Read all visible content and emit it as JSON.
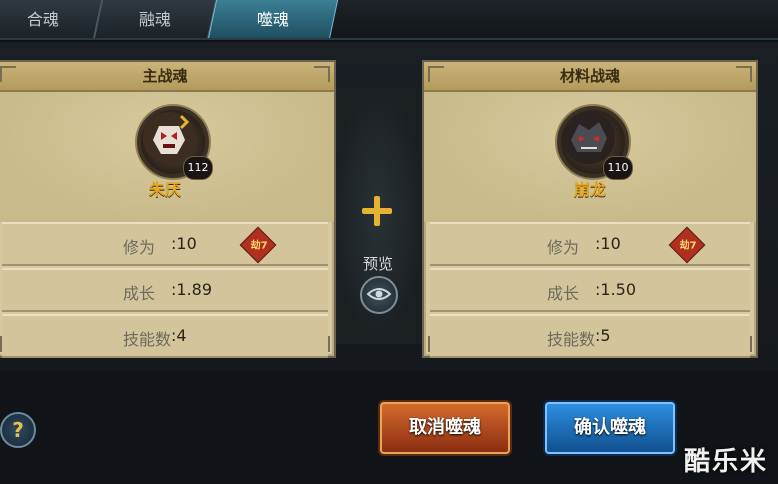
{
  "tabs": [
    {
      "label": "合魂",
      "active": false
    },
    {
      "label": "融魂",
      "active": false
    },
    {
      "label": "噬魂",
      "active": true
    }
  ],
  "main_soul": {
    "header": "主战魂",
    "level": "112",
    "name": "朱厌",
    "stats": [
      {
        "label": "修为",
        "value": ":10",
        "badge": "劫7"
      },
      {
        "label": "成长",
        "value": ":1.89"
      },
      {
        "label": "技能数",
        "value": ":4"
      }
    ]
  },
  "material_soul": {
    "header": "材料战魂",
    "level": "110",
    "name": "崩龙",
    "stats": [
      {
        "label": "修为",
        "value": ":10",
        "badge": "劫7"
      },
      {
        "label": "成长",
        "value": ":1.50"
      },
      {
        "label": "技能数",
        "value": ":5"
      }
    ]
  },
  "middle": {
    "preview_label": "预览"
  },
  "buttons": {
    "help": "?",
    "cancel": "取消噬魂",
    "confirm": "确认噬魂"
  },
  "watermark": "酷乐米",
  "icons": {
    "plus": "plus-icon",
    "preview": "eye-icon",
    "help": "question-icon"
  },
  "colors": {
    "name_gold": "#e5a81f",
    "cancel_red": "#c0521f",
    "confirm_blue": "#2d8ee0",
    "badge_red": "#b0301f"
  }
}
